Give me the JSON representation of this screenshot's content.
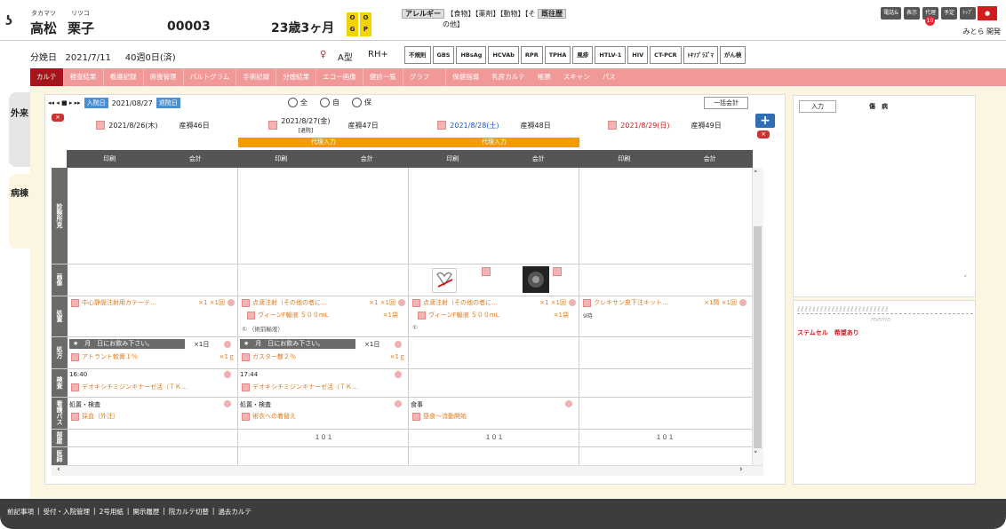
{
  "patient": {
    "logo_glyph": "ʖ",
    "surname_kana": "タカマツ",
    "given_kana": "リツコ",
    "surname": "高松",
    "given_name": "栗子",
    "id": "00003",
    "age": "23歳3ヶ月",
    "og_o": "O",
    "og_g": "G",
    "og_o2": "O",
    "og_p": "P",
    "delivery_label": "分娩日",
    "delivery_date": "2021/7/11",
    "weeks": "40週0日(済)",
    "blood_type": "A型",
    "rh": "RH+",
    "female_symbol": "♀"
  },
  "allergy": {
    "tag": "アレルギー",
    "items": "【食物】【薬剤】【動物】【そ",
    "items2": "の他】",
    "history_tag": "既往歴"
  },
  "top_buttons": [
    "電話&",
    "表示",
    "代理",
    "予定",
    "ﾄｯﾌﾟ"
  ],
  "badge_count": "10",
  "user_name": "みとら 開発",
  "tests": [
    "不規則",
    "GBS",
    "HBsAg",
    "HCVAb",
    "RPR",
    "TPHA",
    "風疹",
    "HTLV-1",
    "HIV",
    "CT-PCR",
    "ﾄｷｿﾌﾟﾗｽﾞﾏ",
    "がん検"
  ],
  "tabs": [
    {
      "label": "カルテ",
      "active": true
    },
    {
      "label": "検査結果"
    },
    {
      "label": "看護記録"
    },
    {
      "label": "術後管理"
    },
    {
      "label": "パルトグラム"
    },
    {
      "label": "手術記録"
    },
    {
      "label": "分娩結果"
    },
    {
      "label": "エコー画像"
    },
    {
      "label": "健診一覧"
    },
    {
      "label": "グラフ"
    },
    {
      "label": "保健指導"
    },
    {
      "label": "乳房カルテ"
    },
    {
      "label": "帳票"
    },
    {
      "label": "スキャン"
    },
    {
      "label": "パス"
    }
  ],
  "side_tabs": {
    "outpatient": "外来",
    "ward": "病棟"
  },
  "controls": {
    "nav": "◂◂ ◂ ■ ▸ ▸▸",
    "admission_label": "入院日",
    "admission_date": "2021/08/27",
    "discharge_label": "退院日",
    "radio_all": "全",
    "radio_self": "自",
    "radio_other": "保",
    "bulk_btn": "一括会計",
    "close_x": "×",
    "plus": "+"
  },
  "days": [
    {
      "date": "2021/8/26(木)",
      "days_label": "産褥46日",
      "color": "#333333",
      "sub": ""
    },
    {
      "date": "2021/8/27(金)",
      "days_label": "産褥47日",
      "color": "#333333",
      "sub": "[退院]"
    },
    {
      "date": "2021/8/28(土)",
      "days_label": "産褥48日",
      "color": "#1a56c4",
      "sub": ""
    },
    {
      "date": "2021/8/29(日)",
      "days_label": "産褥49日",
      "color": "#d01c1c",
      "sub": ""
    }
  ],
  "proxy_label": "代理入力",
  "column_buttons": {
    "print": "印刷",
    "account": "会計"
  },
  "sections": {
    "diagnosis": "診察所見",
    "image": "画像",
    "treatment": "処置",
    "prescription": "処方",
    "exam": "検査",
    "nursing_path": "看護パス",
    "room": "部屋",
    "doctor": "医師"
  },
  "treatment": {
    "c0": {
      "text": "中心静脈注射用カテーテ…",
      "qty": "×1 ×1回"
    },
    "c1a": {
      "text": "点滴注射（その他の者に…",
      "qty": "×1 ×1回"
    },
    "c1b": {
      "text": "ヴィーンF輸液 ５００mL",
      "qty": "×1袋"
    },
    "c1c": "① （術前輸液）",
    "c2a": {
      "text": "点滴注射（その他の者に…",
      "qty": "×1 ×1回"
    },
    "c2b": {
      "text": "ヴィーンF輸液 ５００mL",
      "qty": "×1袋"
    },
    "c2c": "①",
    "c3": {
      "text": "クレキサン皮下注キット…",
      "qty": "×1筒 ×1回"
    },
    "c3sub": "9時"
  },
  "prescription": {
    "bar": "★　月　日にお飲み下さい。",
    "bar_qty": "×1日",
    "c0": {
      "text": "アトラント軟膏１％",
      "qty": "×1ｇ"
    },
    "c1": {
      "text": "ガスター散２％",
      "qty": "×1ｇ"
    }
  },
  "exam": {
    "c0_time": "16:40",
    "c0_text": "デオキシチミジンキナーゼ活（ＴＫ…",
    "c1_time": "17:44",
    "c1_text": "デオキシチミジンキナーゼ活（ＴＫ…"
  },
  "nursing": {
    "c0_head": "処置・検査",
    "c0_text": "採血（外注）",
    "c1_head": "処置・検査",
    "c1_text": "術衣への着替え",
    "c2_head": "食事",
    "c2_text": "昼食～流動開始"
  },
  "room": [
    "１０１",
    "１０１",
    "１０１"
  ],
  "right_panel": {
    "input_btn": "入力",
    "disease_header": "傷　病",
    "memo_deco": "ℓℓℓℓℓℓℓℓℓℓℓℓℓℓℓℓℓℓℓℓℓℓℓℓ",
    "memo_title": "memo",
    "memo_text": "ステムセル　希望あり"
  },
  "footer": [
    "前記事項",
    "|",
    "受付・入院管理",
    "|",
    "2号用紙",
    "|",
    "開示履歴",
    "|",
    "院カルテ切替",
    "|",
    "過去カルテ"
  ]
}
